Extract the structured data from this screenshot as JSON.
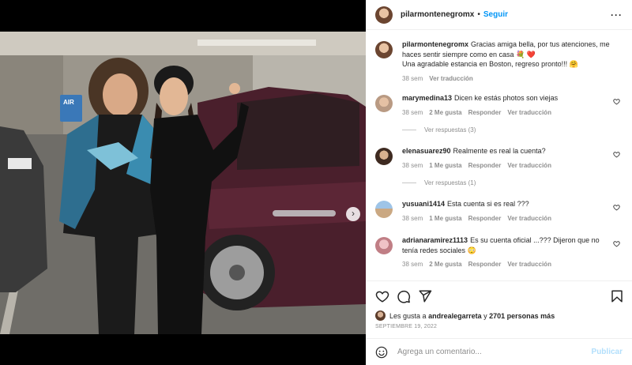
{
  "post": {
    "author": "pilarmontenegromx",
    "separator": "•",
    "follow_label": "Seguir",
    "more_icon": "more-horizontal-icon",
    "caption": {
      "line1": "Gracias amiga bella, por tus atenciones, me haces sentir siempre como en casa 💐 ❤️",
      "line2": "Una agradable estancia en Boston, regreso pronto!!! 🤗",
      "time": "38 sem",
      "translate_label": "Ver traducción"
    }
  },
  "media": {
    "sign_text": "AIR",
    "next_icon": "chevron-right-icon",
    "carousel_dots": 2,
    "active_dot": 1
  },
  "comments": [
    {
      "user": "marymedina13",
      "text": "Dicen ke estás photos son viejas",
      "time": "38 sem",
      "likes": "2 Me gusta",
      "reply": "Responder",
      "translate": "Ver traducción",
      "replies_label": "Ver respuestas (3)"
    },
    {
      "user": "elenasuarez90",
      "text": "Realmente es real la cuenta?",
      "time": "38 sem",
      "likes": "1 Me gusta",
      "reply": "Responder",
      "translate": "Ver traducción",
      "replies_label": "Ver respuestas (1)"
    },
    {
      "user": "yusuani1414",
      "text": "Esta cuenta si es real ???",
      "time": "38 sem",
      "likes": "1 Me gusta",
      "reply": "Responder",
      "translate": "Ver traducción"
    },
    {
      "user": "adrianaramirez1113",
      "text": "Es su cuenta oficial ...??? Dijeron que no tenía redes sociales 😳",
      "time": "38 sem",
      "likes": "2 Me gusta",
      "reply": "Responder",
      "translate": "Ver traducción"
    }
  ],
  "actions": {
    "like_icon": "heart-icon",
    "comment_icon": "comment-icon",
    "share_icon": "send-icon",
    "save_icon": "bookmark-icon"
  },
  "likes": {
    "prefix": "Les gusta a",
    "user": "andrealegarreta",
    "joiner": "y",
    "others": "2701 personas más"
  },
  "date": "SEPTIEMBRE 19, 2022",
  "composer": {
    "emoji_icon": "smiley-icon",
    "placeholder": "Agrega un comentario...",
    "publish_label": "Publicar"
  },
  "colors": {
    "link_blue": "#0095f6",
    "publish_disabled": "#b2dffc",
    "muted": "#8e8e8e"
  }
}
